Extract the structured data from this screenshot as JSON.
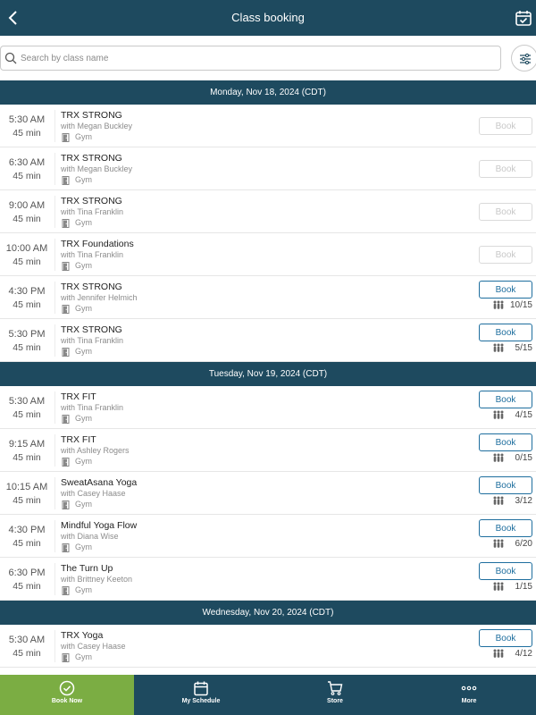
{
  "header": {
    "title": "Class booking"
  },
  "search": {
    "placeholder": "Search by class name"
  },
  "days": [
    {
      "date": "Monday, Nov 18, 2024 (CDT)",
      "classes": [
        {
          "time": "5:30  AM",
          "duration": "45 min",
          "name": "TRX STRONG",
          "instructor": "with Megan Buckley",
          "location": "Gym",
          "book_label": "Book",
          "enabled": false,
          "spots": ""
        },
        {
          "time": "6:30  AM",
          "duration": "45 min",
          "name": "TRX STRONG",
          "instructor": "with Megan Buckley",
          "location": "Gym",
          "book_label": "Book",
          "enabled": false,
          "spots": ""
        },
        {
          "time": "9:00  AM",
          "duration": "45 min",
          "name": "TRX STRONG",
          "instructor": "with Tina Franklin",
          "location": "Gym",
          "book_label": "Book",
          "enabled": false,
          "spots": ""
        },
        {
          "time": "10:00  AM",
          "duration": "45 min",
          "name": "TRX Foundations",
          "instructor": "with Tina Franklin",
          "location": "Gym",
          "book_label": "Book",
          "enabled": false,
          "spots": ""
        },
        {
          "time": "4:30  PM",
          "duration": "45 min",
          "name": "TRX STRONG",
          "instructor": "with Jennifer Helmich",
          "location": "Gym",
          "book_label": "Book",
          "enabled": true,
          "spots": "10/15"
        },
        {
          "time": "5:30  PM",
          "duration": "45 min",
          "name": "TRX STRONG",
          "instructor": "with Tina Franklin",
          "location": "Gym",
          "book_label": "Book",
          "enabled": true,
          "spots": "5/15"
        }
      ]
    },
    {
      "date": "Tuesday, Nov 19, 2024 (CDT)",
      "classes": [
        {
          "time": "5:30  AM",
          "duration": "45 min",
          "name": "TRX FIT",
          "instructor": "with Tina Franklin",
          "location": "Gym",
          "book_label": "Book",
          "enabled": true,
          "spots": "4/15"
        },
        {
          "time": "9:15  AM",
          "duration": "45 min",
          "name": "TRX FIT",
          "instructor": "with Ashley Rogers",
          "location": "Gym",
          "book_label": "Book",
          "enabled": true,
          "spots": "0/15"
        },
        {
          "time": "10:15  AM",
          "duration": "45 min",
          "name": "SweatAsana Yoga",
          "instructor": "with Casey Haase",
          "location": "Gym",
          "book_label": "Book",
          "enabled": true,
          "spots": "3/12"
        },
        {
          "time": "4:30  PM",
          "duration": "45 min",
          "name": "Mindful Yoga Flow",
          "instructor": "with Diana Wise",
          "location": "Gym",
          "book_label": "Book",
          "enabled": true,
          "spots": "6/20"
        },
        {
          "time": "6:30  PM",
          "duration": "45 min",
          "name": "The Turn Up",
          "instructor": "with Brittney Keeton",
          "location": "Gym",
          "book_label": "Book",
          "enabled": true,
          "spots": "1/15"
        }
      ]
    },
    {
      "date": "Wednesday, Nov 20, 2024 (CDT)",
      "classes": [
        {
          "time": "5:30  AM",
          "duration": "45 min",
          "name": "TRX Yoga",
          "instructor": "with Casey Haase",
          "location": "Gym",
          "book_label": "Book",
          "enabled": true,
          "spots": "4/12"
        }
      ]
    }
  ],
  "nav": {
    "items": [
      {
        "label": "Book Now",
        "icon": "check-circle-icon",
        "active": true
      },
      {
        "label": "My Schedule",
        "icon": "calendar-icon",
        "active": false
      },
      {
        "label": "Store",
        "icon": "cart-icon",
        "active": false
      },
      {
        "label": "More",
        "icon": "more-dots-icon",
        "active": false
      }
    ]
  },
  "colors": {
    "header_bg": "#1e4a5f",
    "accent_green": "#7bad43",
    "button_blue": "#1e6e9e"
  }
}
